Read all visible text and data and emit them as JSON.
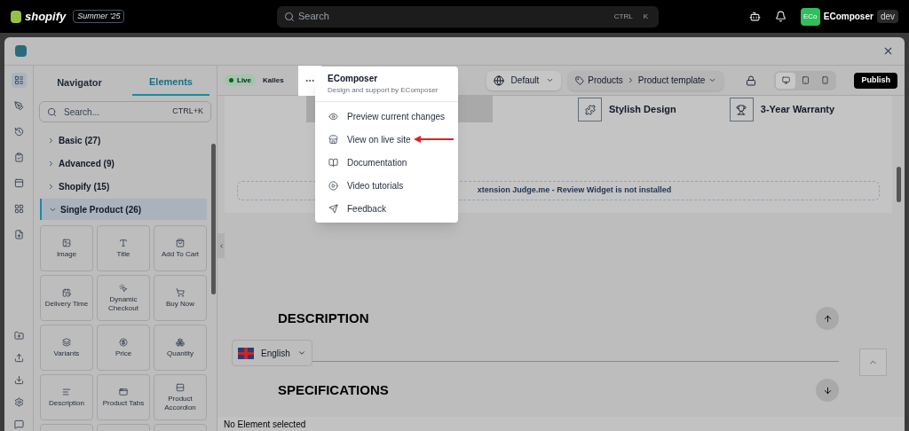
{
  "topbar": {
    "brand": "shopify",
    "badge": "Summer '25",
    "search_placeholder": "Search",
    "shortcut": [
      "CTRL",
      "K"
    ],
    "avatar": "ECo",
    "store": "EComposer",
    "store_badge": "dev"
  },
  "panel": {
    "tabs": [
      {
        "label": "Navigator",
        "selected": false
      },
      {
        "label": "Elements",
        "selected": true
      }
    ],
    "search": {
      "placeholder": "Search...",
      "shortcut": "CTRL+K"
    },
    "categories": [
      {
        "label": "Basic (27)",
        "expanded": false
      },
      {
        "label": "Advanced (9)",
        "expanded": false
      },
      {
        "label": "Shopify (15)",
        "expanded": false
      },
      {
        "label": "Single Product (26)",
        "expanded": true,
        "items": [
          "Image",
          "Title",
          "Add To Cart",
          "Delivery Time",
          "Dynamic Checkout",
          "Buy Now",
          "Variants",
          "Price",
          "Quantity",
          "Description",
          "Product Tabs",
          "Product Accordion"
        ]
      }
    ]
  },
  "toolbar": {
    "status": "Live",
    "theme": "Kalles",
    "menu_open": true,
    "language": "Default",
    "breadcrumb": [
      "Products",
      "Product template"
    ],
    "devices": [
      {
        "kind": "desktop",
        "selected": true
      },
      {
        "kind": "tablet",
        "selected": false
      },
      {
        "kind": "mobile",
        "selected": false
      }
    ],
    "publish": "Publish"
  },
  "menu": {
    "title": "EComposer",
    "subtitle": "Design and support by EComposer",
    "items": [
      {
        "kind": "eye",
        "label": "Preview current changes",
        "annotated": false
      },
      {
        "kind": "store",
        "label": "View on live site",
        "annotated": true
      },
      {
        "kind": "book",
        "label": "Documentation",
        "annotated": false
      },
      {
        "kind": "play",
        "label": "Video tutorials",
        "annotated": false
      },
      {
        "kind": "send",
        "label": "Feedback",
        "annotated": false
      }
    ]
  },
  "canvas": {
    "features": [
      "Stylish Design",
      "3-Year Warranty"
    ],
    "notice": "xtension Judge.me - Review Widget is not installed",
    "sections": [
      {
        "title": "DESCRIPTION",
        "kind": "up"
      },
      {
        "title": "SPECIFICATIONS",
        "kind": "down"
      }
    ],
    "language": "English"
  },
  "status_bar": "No Element selected"
}
